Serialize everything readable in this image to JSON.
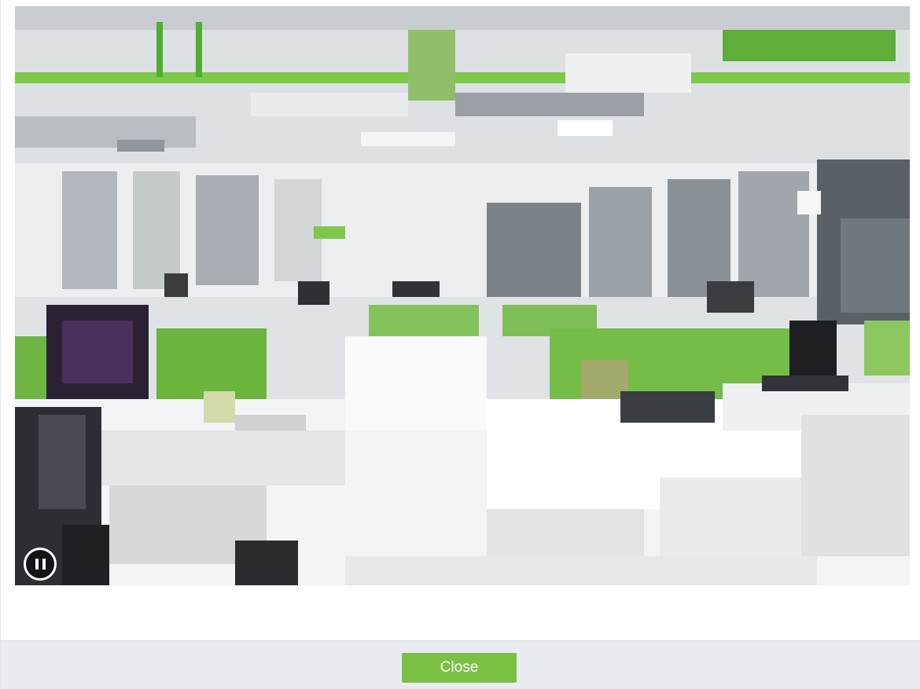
{
  "dialog": {
    "video": {
      "description_icon": "camera-live-feed",
      "pause_icon": "pause-icon"
    },
    "footer": {
      "close_label": "Close",
      "close_color": "#7ac143"
    }
  }
}
